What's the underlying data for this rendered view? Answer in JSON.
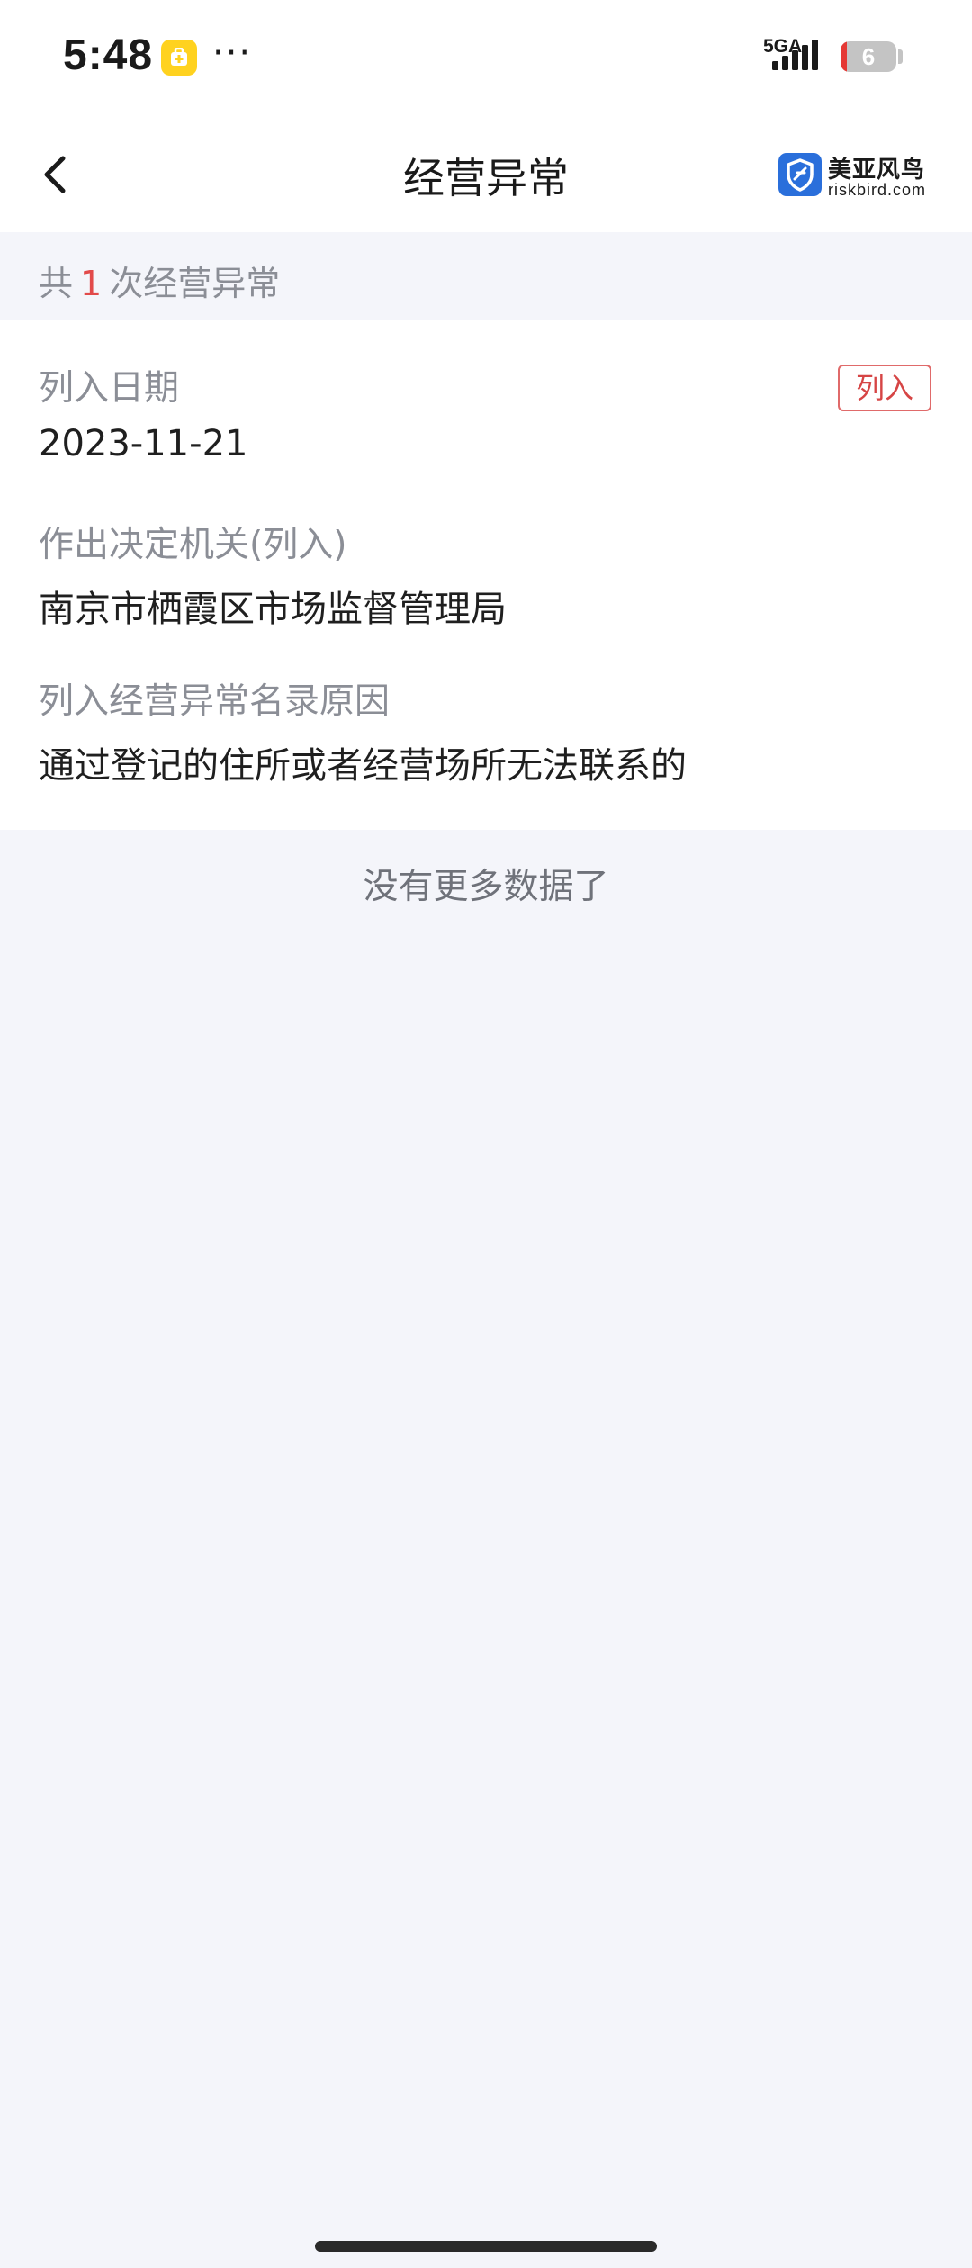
{
  "status_bar": {
    "time": "5:48",
    "more": "···",
    "network": "5GA",
    "battery_level": "6",
    "battery_fraction": 0.06,
    "icons": [
      "app-notification-icon",
      "signal-icon",
      "battery-icon"
    ]
  },
  "nav": {
    "title": "经营异常",
    "back_icon": "chevron-left-icon",
    "brand_name": "美亚风鸟",
    "brand_domain": "riskbird.com",
    "brand_icon": "shield-icon"
  },
  "summary": {
    "prefix": "共",
    "count": "1",
    "suffix": "次经营异常"
  },
  "record": {
    "tag": "列入",
    "fields": [
      {
        "label": "列入日期",
        "value": "2023-11-21"
      },
      {
        "label": "作出决定机关(列入)",
        "value": "南京市栖霞区市场监督管理局"
      },
      {
        "label": "列入经营异常名录原因",
        "value": "通过登记的住所或者经营场所无法联系的"
      }
    ]
  },
  "footer": {
    "end_text": "没有更多数据了"
  },
  "colors": {
    "accent_red": "#e24a4a",
    "brand_blue": "#2a6fdb",
    "page_background": "#f4f5fa",
    "label_gray": "#8b8e96"
  }
}
